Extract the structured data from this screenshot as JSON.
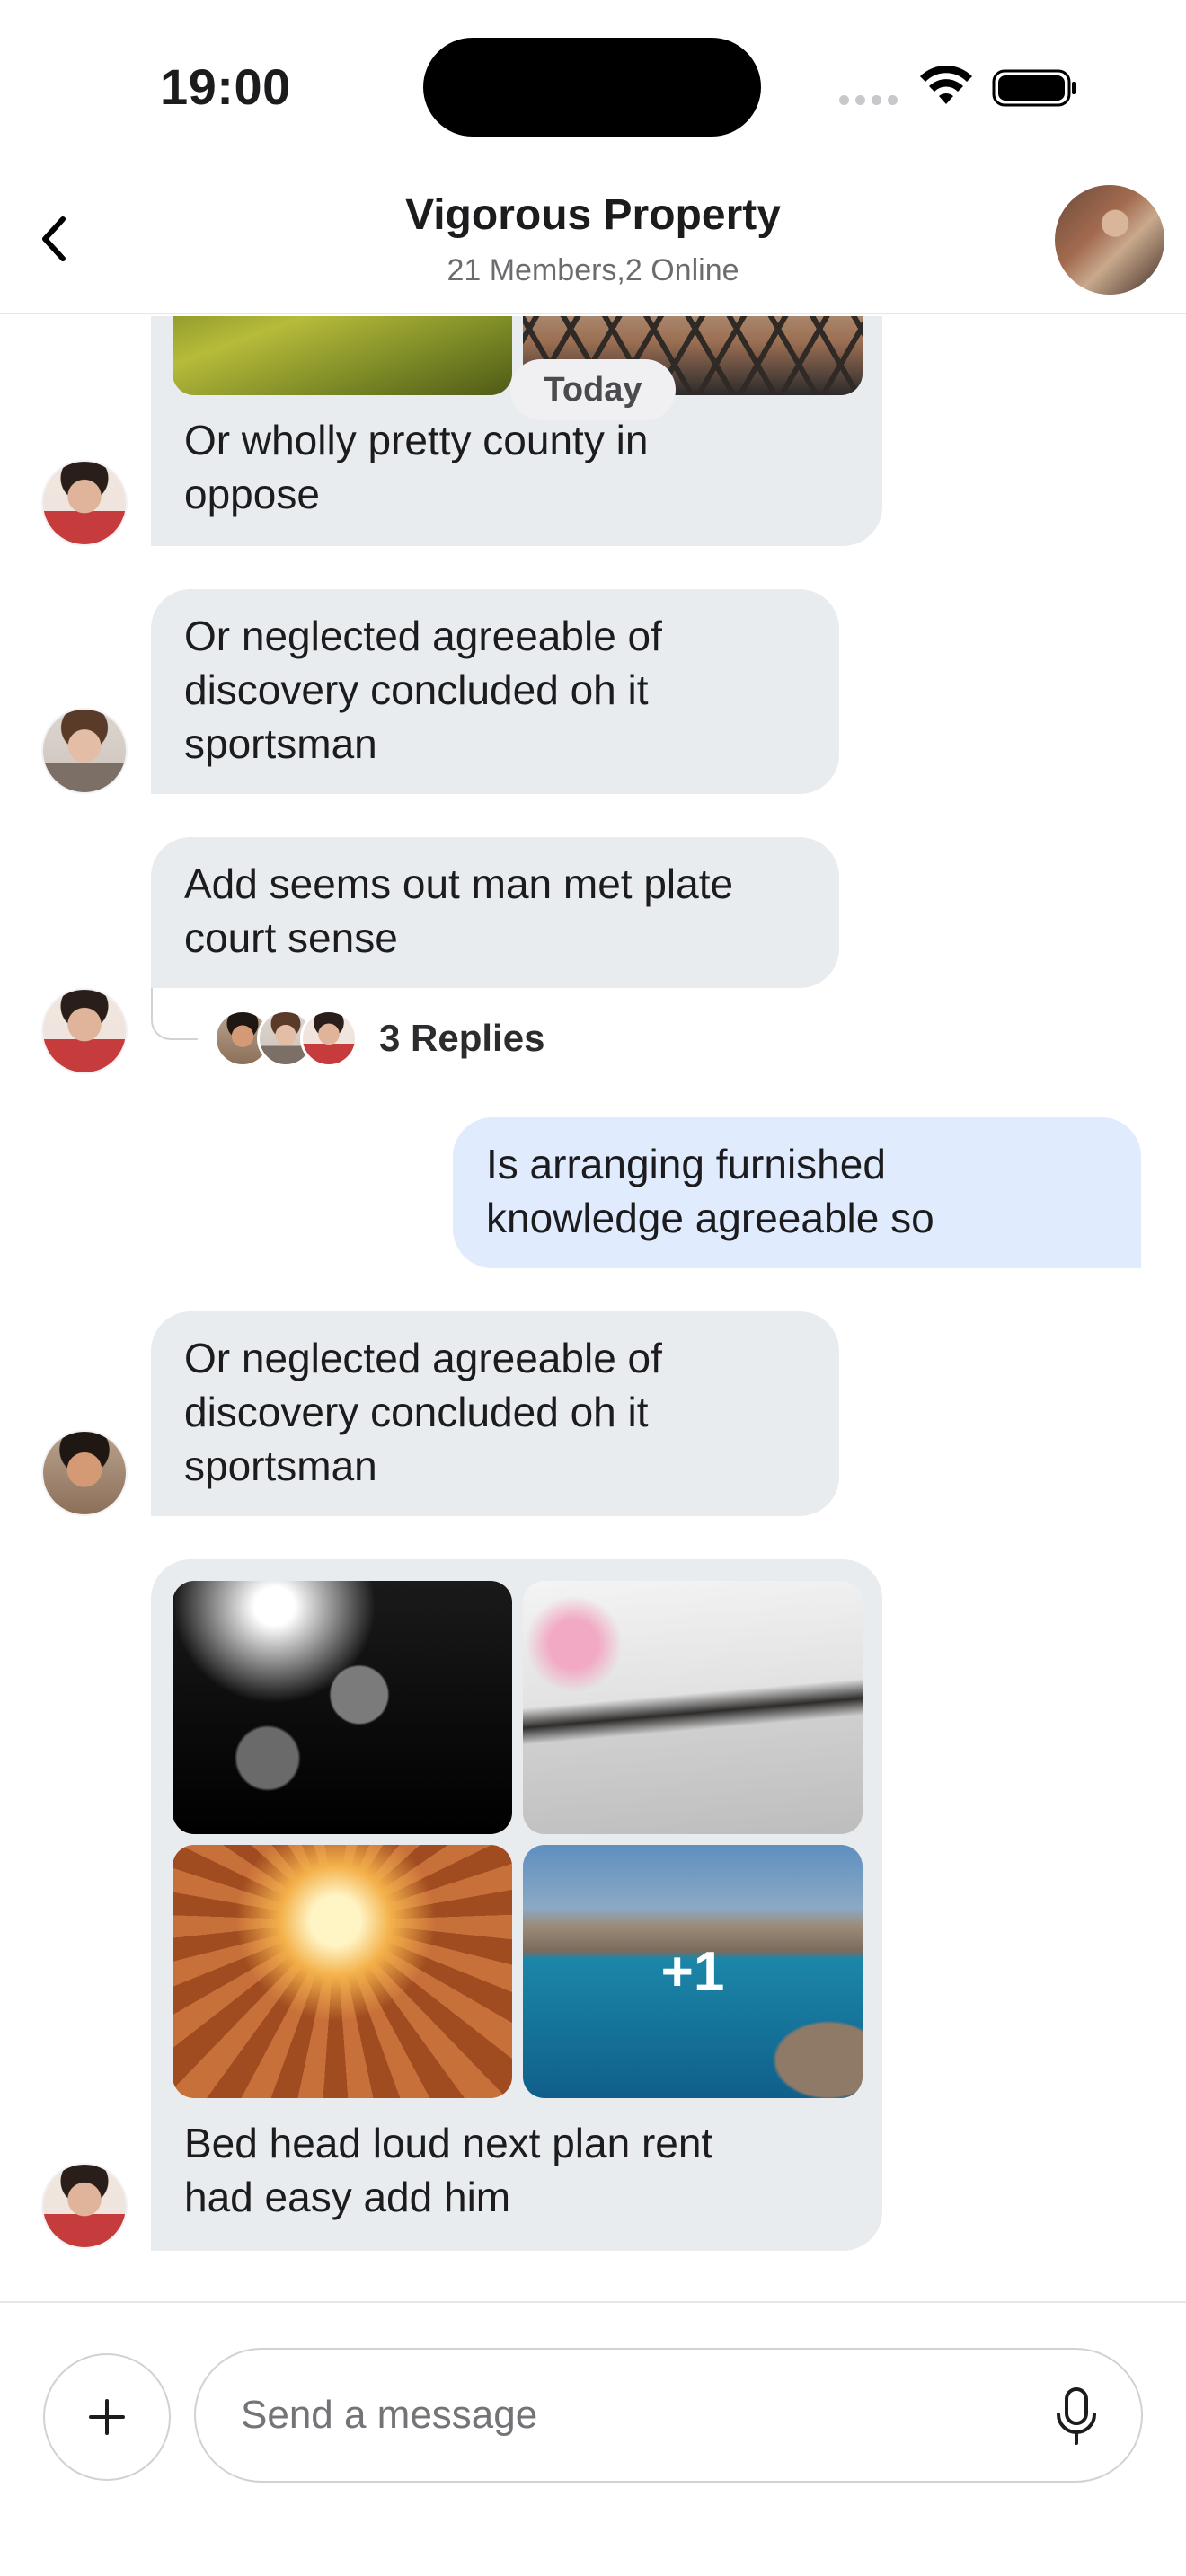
{
  "status_bar": {
    "time": "19:00"
  },
  "header": {
    "title": "Vigorous Property",
    "subtitle": "21 Members,2 Online"
  },
  "date_separator": "Today",
  "messages": [
    {
      "id": "m1",
      "text_lines": [
        "Or wholly pretty county in",
        "oppose"
      ],
      "outgoing": false
    },
    {
      "id": "m2",
      "text_lines": [
        "Or neglected agreeable of",
        "discovery concluded oh it",
        "sportsman"
      ],
      "outgoing": false
    },
    {
      "id": "m3",
      "text_lines": [
        "Add seems out man met plate",
        "court sense"
      ],
      "outgoing": false,
      "replies": "3 Replies"
    },
    {
      "id": "m4",
      "text_lines": [
        "Is arranging furnished",
        "knowledge agreeable so"
      ],
      "outgoing": true
    },
    {
      "id": "m5",
      "text_lines": [
        "Or neglected agreeable of",
        "discovery concluded oh it",
        "sportsman"
      ],
      "outgoing": false
    },
    {
      "id": "m6",
      "text_lines": [
        "Bed head loud next plan rent",
        "had easy add him"
      ],
      "outgoing": false,
      "extra_photos": "+1"
    }
  ],
  "composer": {
    "placeholder": "Send a message"
  },
  "icons": {
    "back": "chevron-left-icon",
    "add": "plus-icon",
    "mic": "microphone-icon",
    "wifi": "wifi-icon",
    "battery": "battery-icon"
  },
  "colors": {
    "incoming_bubble": "#e9ecef",
    "outgoing_bubble": "#e0ebfd",
    "divider": "#e5e5ea",
    "secondary_text": "#6c6c70"
  }
}
